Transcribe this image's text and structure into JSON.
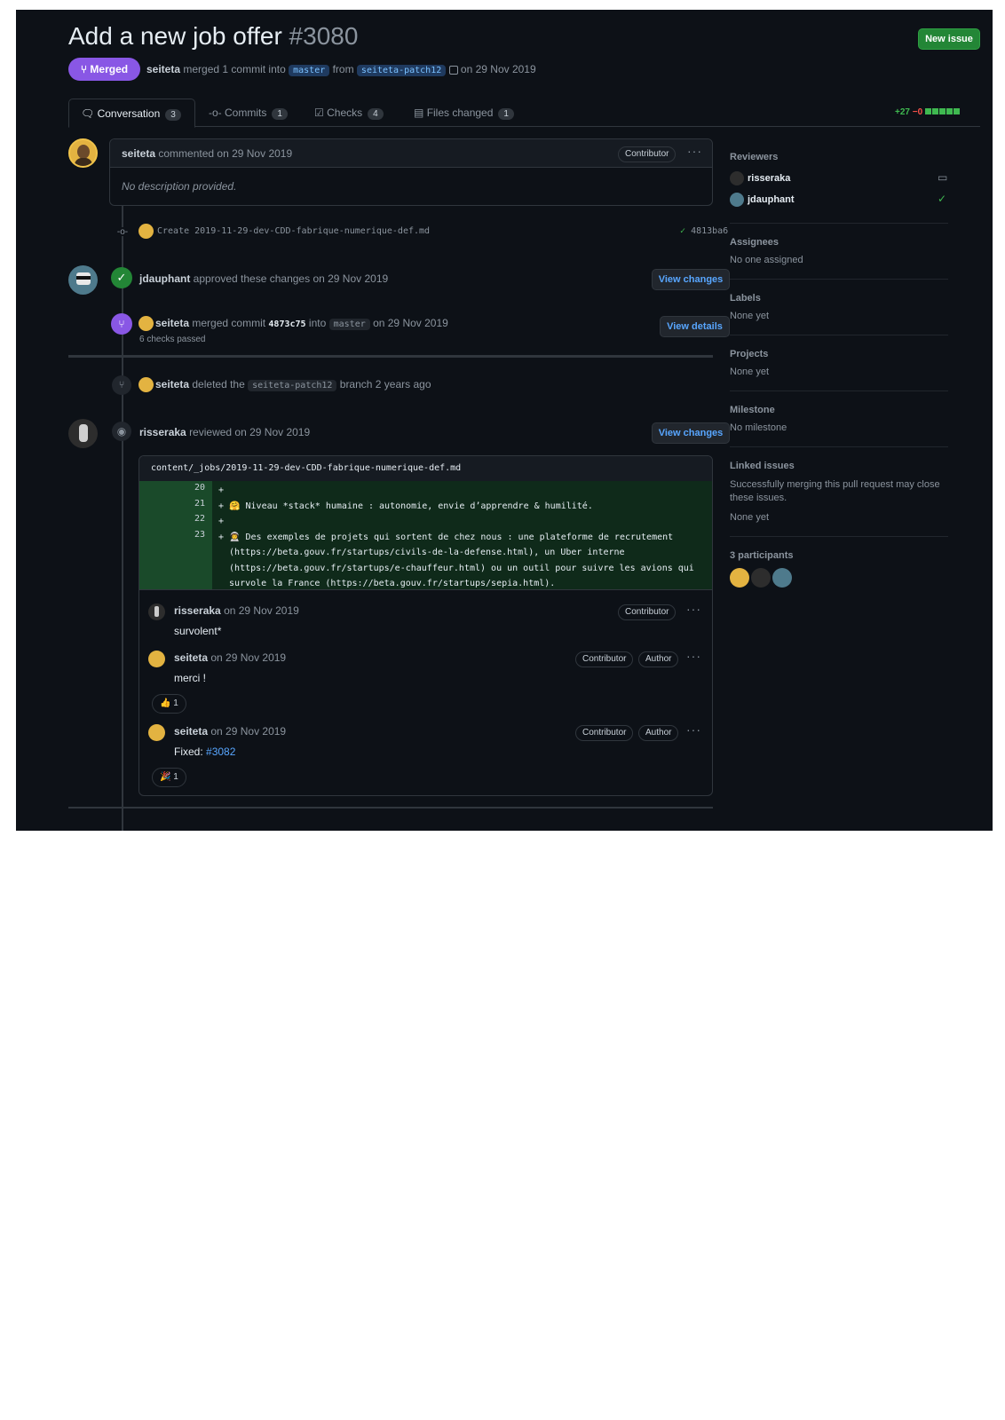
{
  "header": {
    "title": "Add a new job offer",
    "number": "#3080",
    "new_issue": "New issue",
    "state": "Merged",
    "author": "seiteta",
    "merged_text": "merged 1 commit into",
    "base_branch": "master",
    "from_text": "from",
    "head_branch": "seiteta-patch12",
    "date_text": "on 29 Nov 2019"
  },
  "tabs": [
    {
      "label": "Conversation",
      "count": "3"
    },
    {
      "label": "Commits",
      "count": "1"
    },
    {
      "label": "Checks",
      "count": "4"
    },
    {
      "label": "Files changed",
      "count": "1"
    }
  ],
  "diffstat": {
    "added": "+27",
    "removed": "−0"
  },
  "first_comment": {
    "author": "seiteta",
    "action": "commented on 29 Nov 2019",
    "badge": "Contributor",
    "body": "No description provided."
  },
  "commit": {
    "message": "Create 2019-11-29-dev-CDD-fabrique-numerique-def.md",
    "sha": "4813ba6"
  },
  "approval": {
    "author": "jdauphant",
    "text": "approved these changes on 29 Nov 2019",
    "button": "View changes"
  },
  "merge": {
    "author": "seiteta",
    "text": "merged commit",
    "sha": "4873c75",
    "into": "into",
    "branch": "master",
    "date": "on 29 Nov 2019",
    "checks": "6 checks passed",
    "button": "View details"
  },
  "deleted": {
    "author": "seiteta",
    "text": "deleted the",
    "branch": "seiteta-patch12",
    "suffix": "branch 2 years ago"
  },
  "review": {
    "author": "risseraka",
    "text": "reviewed on 29 Nov 2019",
    "button": "View changes",
    "file": "content/_jobs/2019-11-29-dev-CDD-fabrique-numerique-def.md",
    "lines": [
      {
        "num": "20",
        "text": "+"
      },
      {
        "num": "21",
        "text": "+ 🤗 Niveau *stack* humaine : autonomie, envie d’apprendre & humilité."
      },
      {
        "num": "22",
        "text": "+"
      },
      {
        "num": "23",
        "text": "+ 👨‍🚀 Des exemples de projets qui sortent de chez nous : une plateforme de recrutement"
      },
      {
        "num": "",
        "text": "  (https://beta.gouv.fr/startups/civils-de-la-defense.html), un Uber interne"
      },
      {
        "num": "",
        "text": "  (https://beta.gouv.fr/startups/e-chauffeur.html) ou un outil pour suivre les avions qui"
      },
      {
        "num": "",
        "text": "  survole la France (https://beta.gouv.fr/startups/sepia.html)."
      }
    ],
    "comments": [
      {
        "author": "risseraka",
        "date": "on 29 Nov 2019",
        "badges": [
          "Contributor"
        ],
        "body": "survolent*",
        "reaction": ""
      },
      {
        "author": "seiteta",
        "date": "on 29 Nov 2019",
        "badges": [
          "Contributor",
          "Author"
        ],
        "body": "merci !",
        "reaction": "👍 1"
      },
      {
        "author": "seiteta",
        "date": "on 29 Nov 2019",
        "badges": [
          "Contributor",
          "Author"
        ],
        "body_prefix": "Fixed: ",
        "link": "#3082",
        "reaction": "🎉 1"
      }
    ]
  },
  "sidebar": {
    "reviewers_h": "Reviewers",
    "reviewers": [
      "risseraka",
      "jdauphant"
    ],
    "assignees_h": "Assignees",
    "assignees_v": "No one assigned",
    "labels_h": "Labels",
    "labels_v": "None yet",
    "projects_h": "Projects",
    "projects_v": "None yet",
    "milestone_h": "Milestone",
    "milestone_v": "No milestone",
    "linked_h": "Linked issues",
    "linked_desc": "Successfully merging this pull request may close these issues.",
    "linked_v": "None yet",
    "participants_h": "3 participants"
  },
  "colors": {
    "bg": "#0d1117",
    "merged": "#8957e5",
    "green": "#238636",
    "link": "#58a6ff"
  }
}
